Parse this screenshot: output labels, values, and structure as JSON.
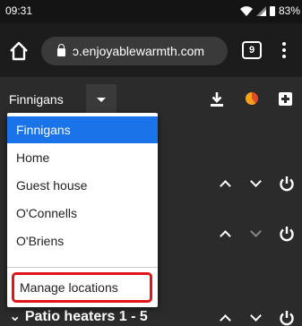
{
  "status": {
    "time": "09:31",
    "battery": "83%"
  },
  "browser": {
    "url": "ɔ.enjoyablewarmth.com",
    "tab_count": "9"
  },
  "toolbar": {
    "location": "Finnigans"
  },
  "dropdown": {
    "options": [
      "Finnigans",
      "Home",
      "Guest house",
      "O'Connells",
      "O'Briens"
    ],
    "selected": "Finnigans",
    "manage_label": "Manage locations"
  },
  "rows": {
    "partial_title": "Patio heaters 1 - 5"
  },
  "colors": {
    "selected": "#1a73e8",
    "highlight": "#e0141b"
  }
}
